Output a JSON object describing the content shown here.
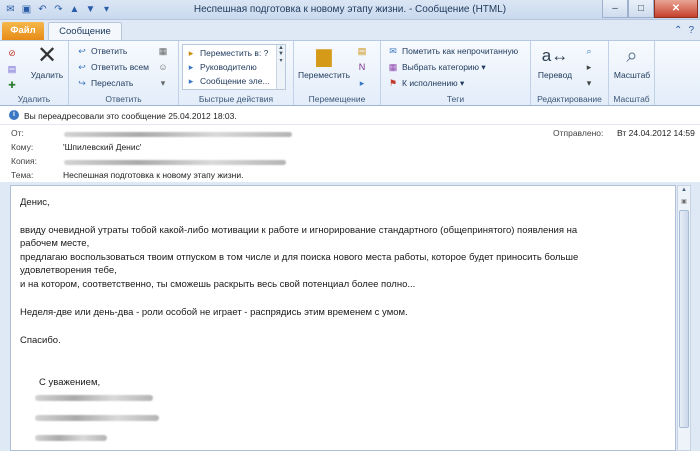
{
  "window": {
    "title": "Неспешная подготовка к новому этапу жизни.  -  Сообщение (HTML)"
  },
  "tabs": {
    "file": "Файл",
    "message": "Сообщение"
  },
  "ribbon": {
    "groups": {
      "delete": "Удалить",
      "respond": "Ответить",
      "quick_steps": "Быстрые действия",
      "move": "Перемещение",
      "tags": "Теги",
      "editing": "Редактирование",
      "zoom": "Масштаб"
    },
    "delete_button": "Удалить",
    "reply": "Ответить",
    "reply_all": "Ответить всем",
    "forward": "Переслать",
    "quick_steps": [
      "Переместить в: ?",
      "Руководителю",
      "Сообщение эле..."
    ],
    "move_button": "Переместить",
    "mark_unread": "Пометить как непрочитанную",
    "categorize": "Выбрать категорию",
    "follow_up": "К исполнению",
    "translate": "Перевод",
    "zoom_button": "Масштаб"
  },
  "header": {
    "info": "Вы переадресовали это сообщение 25.04.2012 18:03.",
    "from_label": "От:",
    "to_label": "Кому:",
    "to_value": "'Шпилевский Денис'",
    "cc_label": "Копия:",
    "subject_label": "Тема:",
    "subject_value": "Неспешная подготовка к новому этапу жизни.",
    "sent_label": "Отправлено:",
    "sent_value": "Вт 24.04.2012 14:59"
  },
  "body": {
    "greeting": "Денис,",
    "lines": [
      "ввиду очевидной утраты тобой какой-либо мотивации к работе и игнорирование стандартного (общепринятого) появления на",
      "рабочем месте,",
      "предлагаю воспользоваться твоим отпуском в том числе и для поиска нового места работы, которое будет приносить больше",
      "удовлетворения тебе,",
      "и на котором, соответственно, ты сможешь раскрыть весь свой потенциал более полно..."
    ],
    "para2": "Неделя-две или день-два - роли особой не играет - распрядись этим временем с умом.",
    "thanks": "Спасибо.",
    "regards": "С уважением,"
  },
  "colors": {
    "file_tab": "#e78a16",
    "accent": "#2a5da8"
  }
}
